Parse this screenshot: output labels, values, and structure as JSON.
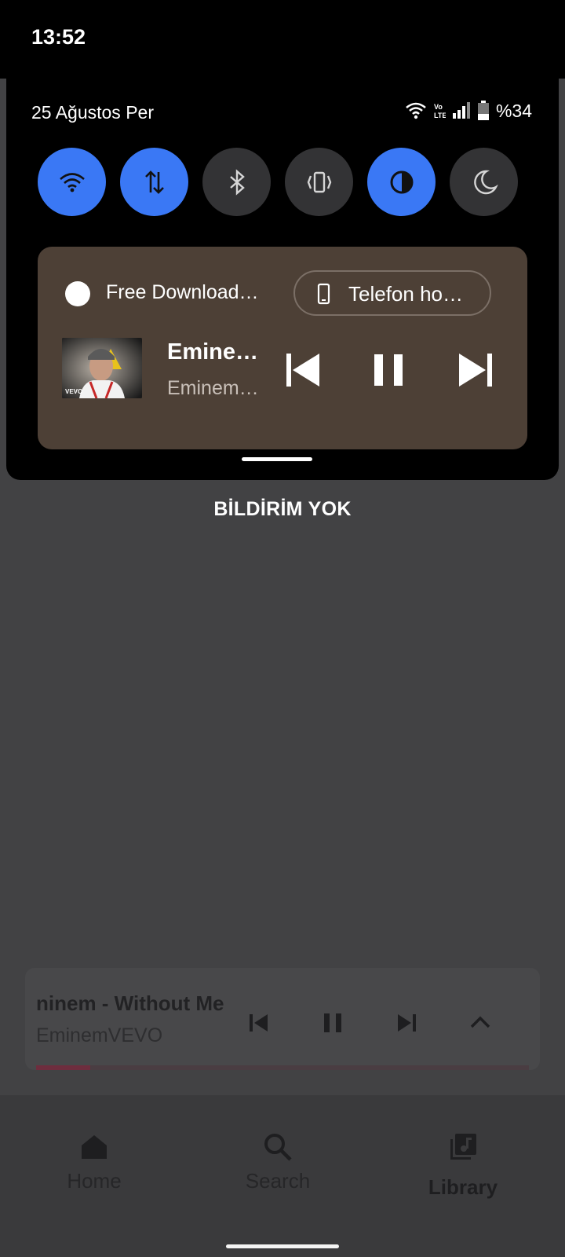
{
  "status_bar": {
    "time": "13:52"
  },
  "quick_settings": {
    "date": "25 Ağustos Per",
    "battery": "%34",
    "signal_icons": [
      "wifi-icon",
      "volte-icon",
      "signal-icon",
      "battery-icon"
    ],
    "tiles": [
      {
        "name": "wifi",
        "icon": "wifi-icon",
        "active": true
      },
      {
        "name": "mobile-data",
        "icon": "data-arrows-icon",
        "active": true
      },
      {
        "name": "bluetooth",
        "icon": "bluetooth-icon",
        "active": false
      },
      {
        "name": "vibrate",
        "icon": "vibrate-icon",
        "active": false
      },
      {
        "name": "dark-mode",
        "icon": "contrast-icon",
        "active": true
      },
      {
        "name": "night-light",
        "icon": "moon-icon",
        "active": false
      }
    ],
    "accent_color": "#3a78f5"
  },
  "media_notification": {
    "app_name": "Free Download…",
    "output_device": "Telefon ho…",
    "track_title": "Emine…",
    "track_artist": "Eminem…",
    "album_art_label": "VEVO",
    "controls": [
      "skip-previous-icon",
      "pause-icon",
      "skip-next-icon"
    ],
    "card_color": "#4d4036"
  },
  "notifications": {
    "empty_text": "BİLDİRİM YOK"
  },
  "mini_player": {
    "title": "ninem - Without Me",
    "artist": "EminemVEVO",
    "progress": 0.11,
    "controls": [
      "skip-previous-icon",
      "pause-icon",
      "skip-next-icon",
      "chevron-up-icon"
    ]
  },
  "bottom_nav": {
    "items": [
      {
        "label": "Home",
        "icon": "home-icon",
        "active": false
      },
      {
        "label": "Search",
        "icon": "search-icon",
        "active": false
      },
      {
        "label": "Library",
        "icon": "library-music-icon",
        "active": true
      }
    ]
  }
}
